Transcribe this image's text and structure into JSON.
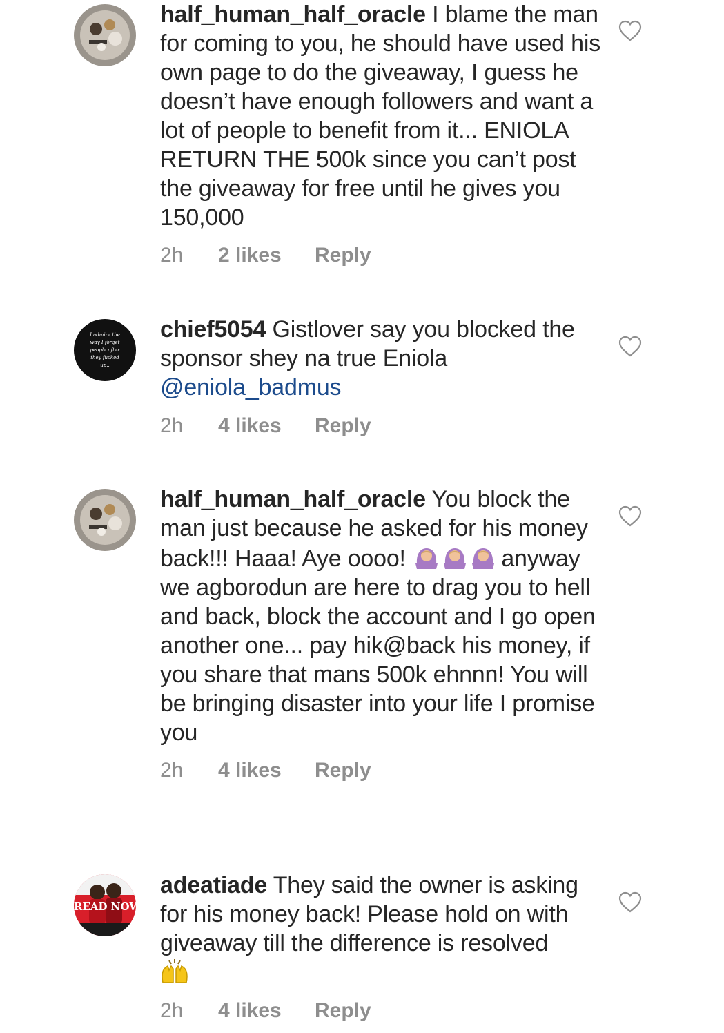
{
  "comments": [
    {
      "username": "half_human_half_oracle",
      "text": "I blame the man for coming to you, he should have used his own page to do the giveaway, I guess he doesn’t have enough followers and want a lot of people to benefit from it... ENIOLA RETURN THE 500k since you can’t post the giveaway for free until he gives you 150,000",
      "time": "2h",
      "likes": "2 likes",
      "reply": "Reply"
    },
    {
      "username": "chief5054",
      "text": "Gistlover say you blocked the sponsor shey na true Eniola",
      "mention": "@eniola_badmus",
      "avatar_text": "I admire the way I forget people after they fucked up..",
      "time": "2h",
      "likes": "4 likes",
      "reply": "Reply"
    },
    {
      "username": "half_human_half_oracle",
      "text_before_emoji": "You block the man just because he asked for his money back!!! Haaa! Aye oooo!",
      "emoji": "🙆🏼‍♀️🙆🏼‍♀️🙆🏼‍♀️",
      "text_after_emoji": "anyway we agborodun are here to drag you to hell and back, block the account and I go open another one... pay hik@back his money, if you share that mans 500k ehnnn! You will be bringing disaster into your life I promise you",
      "time": "2h",
      "likes": "4 likes",
      "reply": "Reply"
    },
    {
      "username": "adeatiade",
      "text": "They said the owner is asking for his money back! Please hold on with giveaway till the difference is resolved",
      "emoji": "🙌",
      "avatar_text": "READ NOW",
      "time": "2h",
      "likes": "4 likes",
      "reply": "Reply"
    }
  ],
  "icons": {
    "like": "heart-outline-icon",
    "emoji_woman_gesturing_ok": "woman-gesturing-ok-icon",
    "emoji_raising_hands": "raising-hands-icon"
  },
  "colors": {
    "text": "#262626",
    "meta": "#8e8e8e",
    "mention": "#1c4b8c",
    "background": "#ffffff"
  }
}
